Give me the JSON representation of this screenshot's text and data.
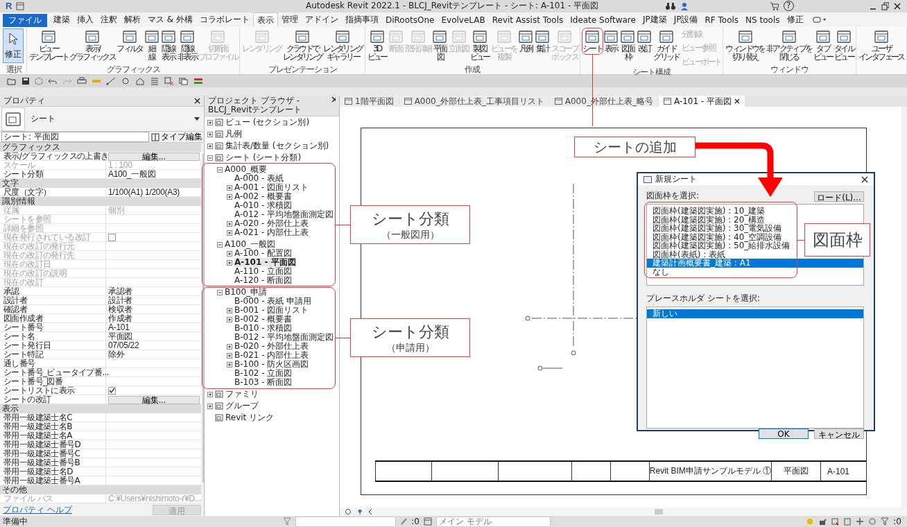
{
  "title_bar": {
    "logo": "R",
    "title": "Autodesk Revit 2022.1 - BLCJ_Revitテンプレート - シート: A-101 - 平面図",
    "help": "?"
  },
  "file_tab": "ファイル",
  "ribbon_tabs": [
    {
      "label": "建築",
      "selected": false
    },
    {
      "label": "挿入",
      "selected": false
    },
    {
      "label": "注釈",
      "selected": false
    },
    {
      "label": "解析",
      "selected": false
    },
    {
      "label": "マス & 外構",
      "selected": false
    },
    {
      "label": "コラボレート",
      "selected": false
    },
    {
      "label": "表示",
      "selected": true
    },
    {
      "label": "管理",
      "selected": false
    },
    {
      "label": "アドイン",
      "selected": false
    },
    {
      "label": "指摘事項",
      "selected": false
    },
    {
      "label": "DiRootsOne",
      "selected": false
    },
    {
      "label": "EvolveLAB",
      "selected": false
    },
    {
      "label": "Revit Assist Tools",
      "selected": false
    },
    {
      "label": "Ideate Software",
      "selected": false
    },
    {
      "label": "JP建築",
      "selected": false
    },
    {
      "label": "JP設備",
      "selected": false
    },
    {
      "label": "RF Tools",
      "selected": false
    },
    {
      "label": "NS tools",
      "selected": false
    },
    {
      "label": "修正",
      "selected": false
    }
  ],
  "ribbon_groups": [
    {
      "label": "選択",
      "modify": {
        "label": "修正",
        "active": true
      }
    },
    {
      "label": "グラフィックス",
      "tools": [
        {
          "lines": [
            "ビュー",
            "テンプレート"
          ],
          "disabled": false
        },
        {
          "lines": [
            "表示/",
            "グラフィックス"
          ],
          "disabled": false
        },
        {
          "lines": [
            "フィルタ"
          ],
          "disabled": false
        },
        {
          "lines": [
            "細",
            "線"
          ],
          "disabled": false
        },
        {
          "lines": [
            "隠線",
            "表示"
          ],
          "disabled": false
        },
        {
          "lines": [
            "隠線",
            "非表示"
          ],
          "disabled": false
        },
        {
          "lines": [
            "切断面",
            "プロファイル"
          ],
          "disabled": true
        }
      ]
    },
    {
      "label": "プレゼンテーション",
      "tools": [
        {
          "lines": [
            "レンダリング"
          ],
          "disabled": true
        },
        {
          "lines": [
            "クラウドで",
            "レンダリング"
          ],
          "disabled": false
        },
        {
          "lines": [
            "レンダリング",
            "ギャラリー"
          ],
          "disabled": false
        }
      ]
    },
    {
      "label": "作成",
      "tools": [
        {
          "lines": [
            "3D",
            "ビュー"
          ],
          "disabled": false
        },
        {
          "lines": [
            "断面"
          ],
          "disabled": true
        },
        {
          "lines": [
            "部分詳細"
          ],
          "disabled": true
        },
        {
          "lines": [
            "平面",
            "図"
          ],
          "disabled": false
        },
        {
          "lines": [
            "立面図"
          ],
          "disabled": true
        },
        {
          "lines": [
            "製図",
            "ビュー"
          ],
          "disabled": false
        },
        {
          "lines": [
            "ビューを",
            "複製"
          ],
          "disabled": true
        },
        {
          "lines": [
            "凡例"
          ],
          "disabled": false
        },
        {
          "lines": [
            "集計"
          ],
          "disabled": false
        },
        {
          "lines": [
            "スコープ",
            "ボックス"
          ],
          "disabled": true
        }
      ]
    },
    {
      "label": "シート構成",
      "tools": [
        {
          "lines": [
            "シート"
          ],
          "disabled": false
        },
        {
          "lines": [
            "表示"
          ],
          "disabled": false
        },
        {
          "lines": [
            "図面",
            "枠"
          ],
          "disabled": false
        },
        {
          "lines": [
            "改訂"
          ],
          "disabled": false
        },
        {
          "lines": [
            "ガイド",
            "グリッド"
          ],
          "disabled": false
        }
      ],
      "small_tools": [
        {
          "label": "分割線",
          "disabled": true
        },
        {
          "label": "ビュー 参照",
          "disabled": true
        },
        {
          "label": "ビューポート",
          "disabled": true
        }
      ]
    },
    {
      "label": "ウィンドウ",
      "tools": [
        {
          "lines": [
            "ウィンドウを",
            "切り替え"
          ],
          "disabled": false
        },
        {
          "lines": [
            "非アクティブを",
            "閉じる"
          ],
          "disabled": false
        },
        {
          "lines": [
            "タブ",
            "ビュー"
          ],
          "disabled": false
        },
        {
          "lines": [
            "タイル",
            "ビュー"
          ],
          "disabled": false
        }
      ]
    },
    {
      "tools": [
        {
          "lines": [
            "ユーザ",
            "インタフェース"
          ],
          "disabled": false
        }
      ]
    }
  ],
  "properties": {
    "title": "プロパティ",
    "type_name": "シート",
    "selector": "シート: 平面図",
    "type_edit": "タイプ編集",
    "sections": [
      {
        "label": "グラフィックス",
        "rows": [
          {
            "name": "表示/グラフィックスの上書き",
            "value": "編集...",
            "kind": "button",
            "disabled": false
          },
          {
            "name": "スケール",
            "value": "1 : 100",
            "kind": "text",
            "disabled": true
          },
          {
            "name": "シート分類",
            "value": "A100_一般図",
            "kind": "text",
            "disabled": false
          }
        ]
      },
      {
        "label": "文字",
        "rows": [
          {
            "name": "尺度（文字）",
            "value": "1/100(A1) 1/200(A3)",
            "kind": "text",
            "disabled": false
          }
        ]
      },
      {
        "label": "識別情報",
        "rows": [
          {
            "name": "従属",
            "value": "個別",
            "kind": "text",
            "disabled": true
          },
          {
            "name": "シートを参照",
            "kind": "text",
            "disabled": true
          },
          {
            "name": "詳細を参照",
            "kind": "text",
            "disabled": true
          },
          {
            "name": "現在発行されている改訂",
            "kind": "checkbox",
            "checked": false,
            "disabled": true
          },
          {
            "name": "現在の改訂の発行元",
            "kind": "text",
            "disabled": true
          },
          {
            "name": "現在の改訂の発行先",
            "kind": "text",
            "disabled": true
          },
          {
            "name": "現在の改訂日",
            "kind": "text",
            "disabled": true
          },
          {
            "name": "現在の改訂の説明",
            "kind": "text",
            "disabled": true
          },
          {
            "name": "現在の改訂",
            "kind": "text",
            "disabled": true
          },
          {
            "name": "承認",
            "value": "承認者",
            "kind": "text",
            "disabled": false
          },
          {
            "name": "設計者",
            "value": "設計者",
            "kind": "text",
            "disabled": false
          },
          {
            "name": "確認者",
            "value": "検収者",
            "kind": "text",
            "disabled": false
          },
          {
            "name": "図面作成者",
            "value": "作成者",
            "kind": "text",
            "disabled": false
          },
          {
            "name": "シート番号",
            "value": "A-101",
            "kind": "text",
            "disabled": false
          },
          {
            "name": "シート名",
            "value": "平面図",
            "kind": "text",
            "disabled": false
          },
          {
            "name": "シート発行日",
            "value": "07/05/22",
            "kind": "text",
            "disabled": false
          },
          {
            "name": "シート特記",
            "value": "除外",
            "kind": "text",
            "disabled": false
          },
          {
            "name": "通し番号",
            "kind": "text",
            "disabled": false
          },
          {
            "name": "シート番号_ビュータイプ番...",
            "kind": "text",
            "disabled": false
          },
          {
            "name": "シート番号_図番",
            "kind": "text",
            "disabled": false
          },
          {
            "name": "シートリストに表示",
            "kind": "checkbox",
            "checked": true,
            "disabled": false
          },
          {
            "name": "シートの改訂",
            "value": "編集...",
            "kind": "button",
            "disabled": false
          }
        ]
      },
      {
        "label": "表示",
        "rows": [
          {
            "name": "帯用一級建築士名C",
            "kind": "text",
            "disabled": false
          },
          {
            "name": "帯用一級建築士名B",
            "kind": "text",
            "disabled": false
          },
          {
            "name": "帯用一級建築士名A",
            "kind": "text",
            "disabled": false
          },
          {
            "name": "帯用一級建築士番号D",
            "kind": "text",
            "disabled": false
          },
          {
            "name": "帯用一級建築士番号C",
            "kind": "text",
            "disabled": false
          },
          {
            "name": "帯用一級建築士番号B",
            "kind": "text",
            "disabled": false
          },
          {
            "name": "帯用一級建築士名D",
            "kind": "text",
            "disabled": false
          },
          {
            "name": "帯用一級建築士番号A",
            "kind": "text",
            "disabled": false
          }
        ]
      },
      {
        "label": "その他",
        "rows": [
          {
            "name": "ファイル パス",
            "value": "C:¥Users¥nishimoto-r¥D...",
            "kind": "text",
            "disabled": true
          }
        ]
      }
    ],
    "help": "プロパティ ヘルプ",
    "apply": "適用"
  },
  "project_browser": {
    "title": "プロジェクト ブラウザ - BLCJ_Revitテンプレート",
    "items": [
      {
        "label": "ビュー (セクション別)",
        "expanded": false,
        "selected": false
      },
      {
        "label": "凡例",
        "expanded": false,
        "selected": false
      },
      {
        "label": "集計表/数量 (セクション別)",
        "expanded": false,
        "selected": false
      },
      {
        "label": "シート (シート分類)",
        "expanded": true,
        "selected": false,
        "children": [
          {
            "label": "A000_概要",
            "expanded": true,
            "selected": false,
            "children": [
              {
                "label": "A-000 - 表紙",
                "selected": false
              },
              {
                "label": "A-001 - 図面リスト",
                "expanded": false,
                "selected": false
              },
              {
                "label": "A-002 - 概要書",
                "expanded": false,
                "selected": false
              },
              {
                "label": "A-010 - 求積図",
                "selected": false
              },
              {
                "label": "A-012 - 平均地盤面測定図",
                "selected": false
              },
              {
                "label": "A-020 - 外部仕上表",
                "expanded": false,
                "selected": false
              },
              {
                "label": "A-021 - 内部仕上表",
                "expanded": false,
                "selected": false
              }
            ]
          },
          {
            "label": "A100_一般図",
            "expanded": true,
            "selected": false,
            "children": [
              {
                "label": "A-100 - 配置図",
                "expanded": false,
                "selected": false
              },
              {
                "label": "A-101 - 平面図",
                "expanded": false,
                "selected": true
              },
              {
                "label": "A-110 - 立面図",
                "selected": false
              },
              {
                "label": "A-120 - 断面図",
                "selected": false
              }
            ]
          },
          {
            "label": "B100_申請",
            "expanded": true,
            "selected": false,
            "children": [
              {
                "label": "B-000 - 表紙 申請用",
                "selected": false
              },
              {
                "label": "B-001 - 図面リスト",
                "expanded": false,
                "selected": false
              },
              {
                "label": "B-002 - 概要書",
                "expanded": false,
                "selected": false
              },
              {
                "label": "B-010 - 求積図",
                "selected": false
              },
              {
                "label": "B-012 - 平均地盤面測定図",
                "selected": false
              },
              {
                "label": "B-020 - 外部仕上表",
                "expanded": false,
                "selected": false
              },
              {
                "label": "B-021 - 内部仕上表",
                "expanded": false,
                "selected": false
              },
              {
                "label": "B-100 - 防火区画図",
                "expanded": false,
                "selected": false
              },
              {
                "label": "B-102 - 立面図",
                "selected": false
              },
              {
                "label": "B-103 - 断面図",
                "selected": false
              }
            ]
          }
        ]
      },
      {
        "label": "ファミリ",
        "expanded": false,
        "selected": false
      },
      {
        "label": "グループ",
        "expanded": false,
        "selected": false
      },
      {
        "label": "Revit リンク",
        "selected": false
      }
    ]
  },
  "view_tabs": [
    {
      "label": "1階平面図",
      "selected": false
    },
    {
      "label": "A000_外部仕上表_工事項目リスト",
      "selected": false
    },
    {
      "label": "A000_外部仕上表_略号",
      "selected": false
    },
    {
      "label": "A-101 - 平面図",
      "selected": true
    }
  ],
  "title_block": {
    "project": "Revit BIM申請サンプルモデル ①",
    "sheet_name": "平面図",
    "sheet_number": "A-101"
  },
  "dialog": {
    "title": "新規シート",
    "title_block_label": "図面枠を選択:",
    "load": "ロード(L)...",
    "title_blocks": [
      {
        "label": "図面枠(建築図実施) : 10_建築",
        "selected": false
      },
      {
        "label": "図面枠(建築図実施) : 20_構造",
        "selected": false
      },
      {
        "label": "図面枠(建築図実施) : 30_電気設備",
        "selected": false
      },
      {
        "label": "図面枠(建築図実施) : 40_空調設備",
        "selected": false
      },
      {
        "label": "図面枠(建築図実施) : 50_給排水設備",
        "selected": false
      },
      {
        "label": "図面枠(表紙) : 表紙",
        "selected": false
      },
      {
        "label": "建築計画概要書_建築 : A1",
        "selected": true
      },
      {
        "label": "なし",
        "selected": false
      }
    ],
    "placeholder_label": "プレースホルダ シートを選択:",
    "placeholders": [
      {
        "label": "新しい",
        "selected": true
      }
    ],
    "ok": "OK",
    "cancel": "キャンセル"
  },
  "annotations": {
    "add_sheet": "シートの追加",
    "categories": [
      {
        "title": "シート分類",
        "note": "（一般図用）"
      },
      {
        "title": "シート分類",
        "note": "（申請用）"
      }
    ],
    "title_block": "図面枠"
  },
  "status_bar": {
    "message": "準備中",
    "edit_count": ":0",
    "workset": "メイン モデル",
    "filter_count": ":0"
  }
}
